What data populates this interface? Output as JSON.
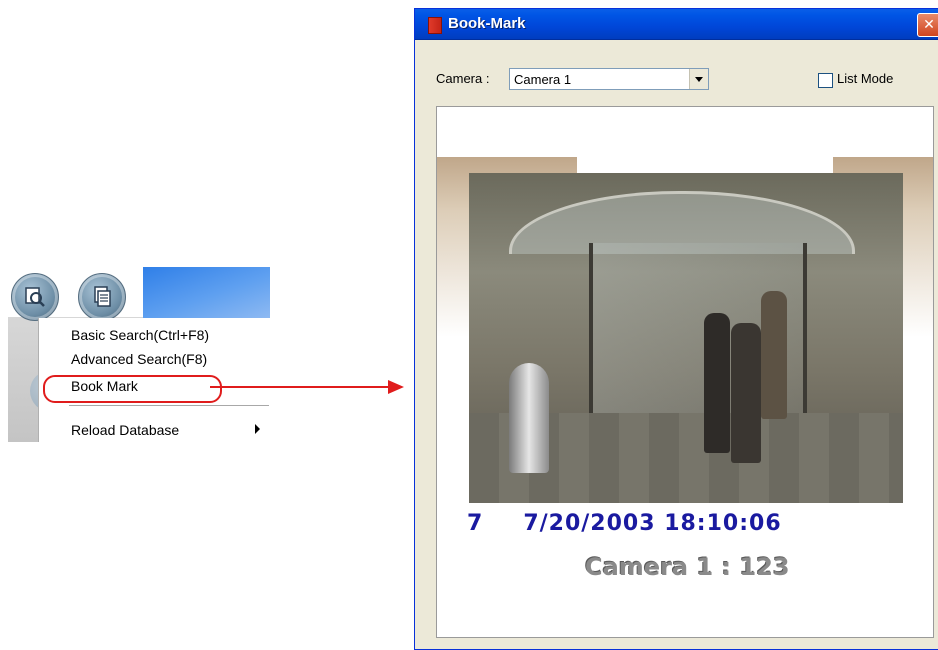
{
  "context_menu": {
    "items": [
      {
        "label": "Basic Search(Ctrl+F8)"
      },
      {
        "label": "Advanced Search(F8)"
      },
      {
        "label": "Book Mark"
      },
      {
        "label": "Reload Database"
      }
    ]
  },
  "icons": {
    "search_button": "search-icon",
    "report_button": "document-icon",
    "submenu": "chevron-right-icon"
  },
  "dialog": {
    "title": "Book-Mark",
    "close_label": "✕",
    "camera_label": "Camera :",
    "camera_value": "Camera 1",
    "list_mode_label": "List Mode",
    "list_mode_checked": false,
    "preview": {
      "channel": "7",
      "timestamp": "7/20/2003 18:10:06",
      "caption": "Camera 1 : 123"
    }
  },
  "colors": {
    "highlight": "#e01c1c",
    "titlebar": "#0055e5",
    "timestamp_text": "#1a1aa0"
  }
}
